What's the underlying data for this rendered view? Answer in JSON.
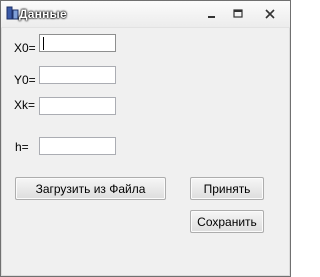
{
  "window": {
    "title": "Данные",
    "controls": {
      "minimize": "minimize-icon",
      "restore": "restore-icon",
      "close": "close-icon"
    }
  },
  "fields": [
    {
      "label": "X0=",
      "value": ""
    },
    {
      "label": "Y0=",
      "value": ""
    },
    {
      "label": "Xk=",
      "value": ""
    },
    {
      "label": "h=",
      "value": ""
    }
  ],
  "buttons": {
    "load": "Загрузить из Файла",
    "accept": "Принять",
    "save": "Сохранить"
  },
  "colors": {
    "window_bg": "#f0f0f0",
    "border": "#adadad"
  }
}
